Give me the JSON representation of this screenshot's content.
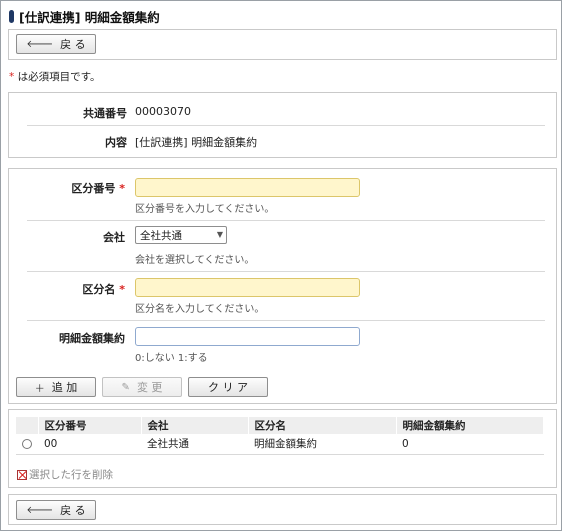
{
  "page": {
    "title": "[仕訳連携] 明細金額集約",
    "back_label": "戻 る",
    "required_note": "は必須項目です。",
    "required_mark": "*"
  },
  "info": {
    "common_no_label": "共通番号",
    "common_no_value": "00003070",
    "content_label": "内容",
    "content_value": "[仕訳連携] 明細金額集約"
  },
  "form": {
    "division_no": {
      "label": "区分番号",
      "value": "",
      "hint": "区分番号を入力してください。"
    },
    "company": {
      "label": "会社",
      "value": "全社共通",
      "hint": "会社を選択してください。"
    },
    "division_name": {
      "label": "区分名",
      "value": "",
      "hint": "区分名を入力してください。"
    },
    "aggregate": {
      "label": "明細金額集約",
      "value": "",
      "hint": "0:しない 1:する"
    }
  },
  "actions": {
    "add": "追 加",
    "change": "変 更",
    "clear": "ク リ ア"
  },
  "table": {
    "headers": [
      "区分番号",
      "会社",
      "区分名",
      "明細金額集約"
    ],
    "rows": [
      {
        "division_no": "00",
        "company": "全社共通",
        "division_name": "明細金額集約",
        "aggregate": "0"
      }
    ],
    "delete_label": "選択した行を削除"
  },
  "colors": {
    "required_input_bg": "#fff6cc",
    "required_mark": "#d9201d",
    "title_mark": "#1f3864"
  }
}
